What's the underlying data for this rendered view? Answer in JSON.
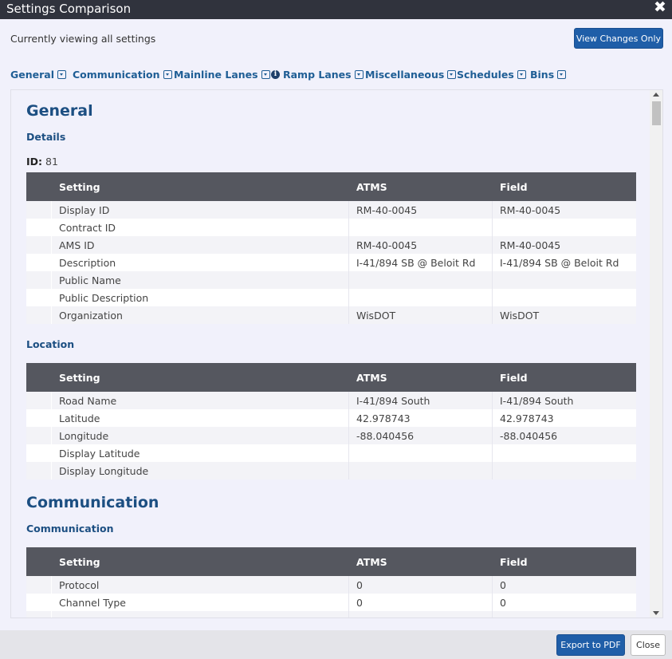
{
  "window": {
    "title": "Settings Comparison",
    "close_glyph": "✖"
  },
  "subheader": {
    "viewing_text": "Currently viewing all settings",
    "view_changes_label": "View Changes Only"
  },
  "tabs": [
    {
      "label": "General"
    },
    {
      "label": "Communication"
    },
    {
      "label": "Mainline Lanes"
    },
    {
      "label": "Ramp Lanes",
      "icon": "info-icon"
    },
    {
      "label": "Miscellaneous"
    },
    {
      "label": "Schedules"
    },
    {
      "label": "Bins"
    }
  ],
  "general": {
    "heading": "General",
    "details": {
      "heading": "Details",
      "id_label": "ID:",
      "id_value": "81",
      "columns": [
        "Setting",
        "ATMS",
        "Field"
      ],
      "rows": [
        {
          "setting": "Display ID",
          "atms": "RM-40-0045",
          "field": "RM-40-0045"
        },
        {
          "setting": "Contract ID",
          "atms": "",
          "field": ""
        },
        {
          "setting": "AMS ID",
          "atms": "RM-40-0045",
          "field": "RM-40-0045"
        },
        {
          "setting": "Description",
          "atms": "I-41/894 SB @ Beloit Rd",
          "field": "I-41/894 SB @ Beloit Rd"
        },
        {
          "setting": "Public Name",
          "atms": "",
          "field": ""
        },
        {
          "setting": "Public Description",
          "atms": "",
          "field": ""
        },
        {
          "setting": "Organization",
          "atms": "WisDOT",
          "field": "WisDOT"
        }
      ]
    },
    "location": {
      "heading": "Location",
      "columns": [
        "Setting",
        "ATMS",
        "Field"
      ],
      "rows": [
        {
          "setting": "Road Name",
          "atms": "I-41/894 South",
          "field": "I-41/894 South"
        },
        {
          "setting": "Latitude",
          "atms": "42.978743",
          "field": "42.978743"
        },
        {
          "setting": "Longitude",
          "atms": "-88.040456",
          "field": "-88.040456"
        },
        {
          "setting": "Display Latitude",
          "atms": "",
          "field": ""
        },
        {
          "setting": "Display Longitude",
          "atms": "",
          "field": ""
        }
      ]
    }
  },
  "communication": {
    "heading": "Communication",
    "section": {
      "heading": "Communication",
      "columns": [
        "Setting",
        "ATMS",
        "Field"
      ],
      "rows": [
        {
          "setting": "Protocol",
          "atms": "0",
          "field": "0"
        },
        {
          "setting": "Channel Type",
          "atms": "0",
          "field": "0"
        }
      ]
    }
  },
  "footer": {
    "export_label": "Export to PDF",
    "close_label": "Close"
  }
}
